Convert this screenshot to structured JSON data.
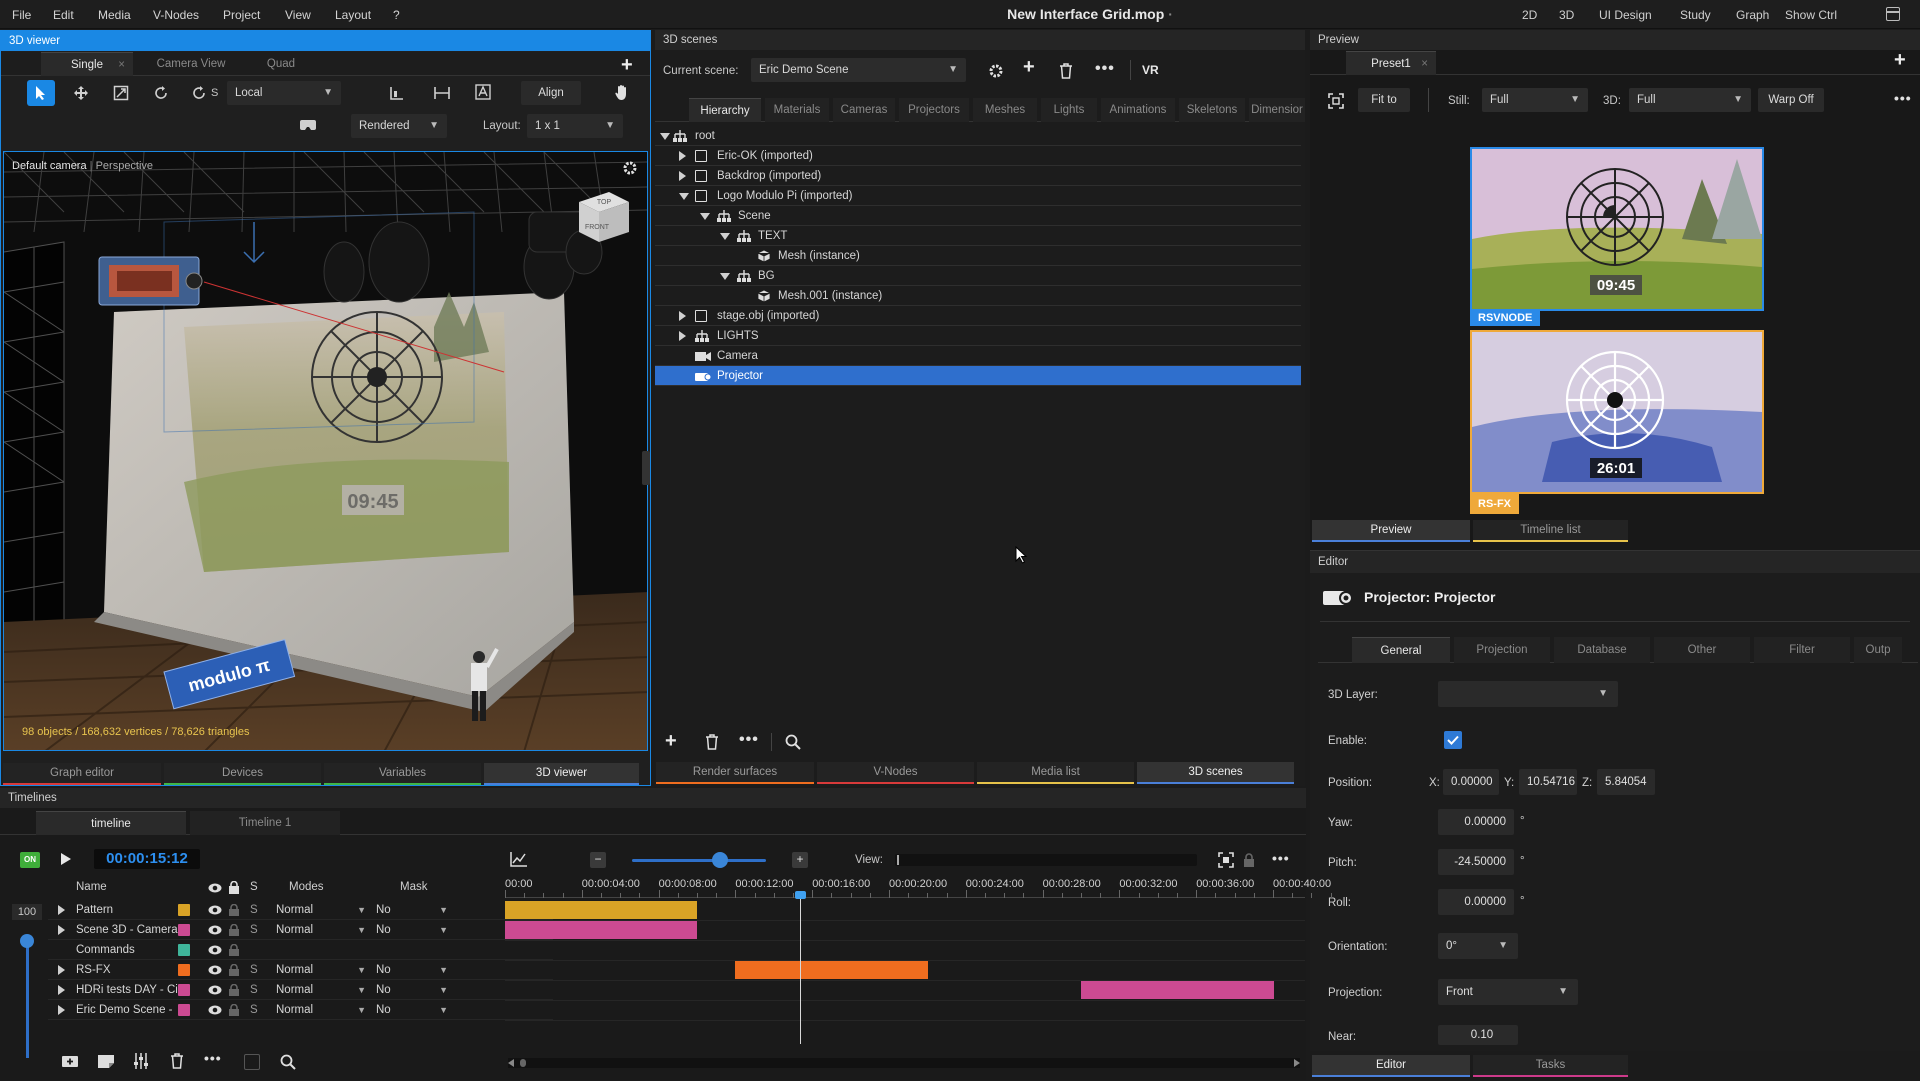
{
  "menu": {
    "file": "File",
    "edit": "Edit",
    "media": "Media",
    "vnodes": "V-Nodes",
    "project": "Project",
    "view": "View",
    "layout": "Layout",
    "help": "?"
  },
  "app_title": "New Interface Grid.mop",
  "title_dot": "·",
  "top_right": {
    "m2d": "2D",
    "m3d": "3D",
    "ui": "UI Design",
    "study": "Study",
    "graph": "Graph",
    "showctrl": "Show Ctrl"
  },
  "viewer": {
    "header": "3D viewer",
    "tabs": {
      "single": "Single",
      "camera": "Camera View",
      "quad": "Quad"
    },
    "space": "Local",
    "snap": "S",
    "align": "Align",
    "render_mode": "Rendered",
    "layout_label": "Layout:",
    "layout_value": "1 x 1",
    "camera_name": "Default camera",
    "camera_sep": "|",
    "camera_mode": "Perspective",
    "gizmo_top": "TOP",
    "gizmo_front": "FRONT",
    "clock": "09:45",
    "logo_text": "modulo π",
    "stats": "98 objects / 168,632 vertices / 78,626 triangles",
    "bottom_tabs": {
      "graph": "Graph editor",
      "devices": "Devices",
      "variables": "Variables",
      "viewer": "3D viewer"
    }
  },
  "scenes": {
    "header": "3D scenes",
    "current_label": "Current scene:",
    "current_value": "Eric Demo Scene",
    "vr": "VR",
    "tabs": {
      "hierarchy": "Hierarchy",
      "materials": "Materials",
      "cameras": "Cameras",
      "projectors": "Projectors",
      "meshes": "Meshes",
      "lights": "Lights",
      "animations": "Animations",
      "skeletons": "Skeletons",
      "dimensions": "Dimensior"
    },
    "tree": {
      "root": "root",
      "eric": "Eric-OK (imported)",
      "backdrop": "Backdrop (imported)",
      "logo": "Logo Modulo Pi (imported)",
      "scene": "Scene",
      "text": "TEXT",
      "mesh": "Mesh (instance)",
      "bg": "BG",
      "mesh001": "Mesh.001 (instance)",
      "stage": "stage.obj (imported)",
      "lights": "LIGHTS",
      "camera": "Camera",
      "projector": "Projector"
    },
    "bottom_tabs": {
      "render": "Render surfaces",
      "vnodes": "V-Nodes",
      "media": "Media list",
      "scenes": "3D scenes"
    }
  },
  "preview": {
    "header": "Preview",
    "tab": "Preset1",
    "fit": "Fit to",
    "still_label": "Still:",
    "still_value": "Full",
    "d3_label": "3D:",
    "d3_value": "Full",
    "warp": "Warp Off",
    "clock1": "09:45",
    "clock2": "26:01",
    "label1": "RSVNODE",
    "label2": "RS-FX",
    "tabs": {
      "preview": "Preview",
      "timeline": "Timeline list"
    }
  },
  "editor": {
    "header": "Editor",
    "title": "Projector: Projector",
    "tabs": {
      "general": "General",
      "projection": "Projection",
      "database": "Database",
      "other": "Other",
      "filter": "Filter",
      "output": "Outp"
    },
    "layer_label": "3D Layer:",
    "enable_label": "Enable:",
    "position_label": "Position:",
    "x_label": "X:",
    "x": "0.00000",
    "y_label": "Y:",
    "y": "10.54716",
    "z_label": "Z:",
    "z": "5.84054",
    "yaw_label": "Yaw:",
    "yaw": "0.00000",
    "pitch_label": "Pitch:",
    "pitch": "-24.50000",
    "roll_label": "Roll:",
    "roll": "0.00000",
    "deg": "°",
    "orientation_label": "Orientation:",
    "orientation": "0°",
    "projection_label": "Projection:",
    "projection": "Front",
    "near_label": "Near:",
    "near": "0.10",
    "bottom_tabs": {
      "editor": "Editor",
      "tasks": "Tasks"
    }
  },
  "timelines": {
    "header": "Timelines",
    "tabs": {
      "timeline": "timeline",
      "timeline1": "Timeline 1"
    },
    "on": "ON",
    "time": "00:00:15:12",
    "view_label": "View:",
    "zoom": "100",
    "cols": {
      "name": "Name",
      "s": "S",
      "modes": "Modes",
      "mask": "Mask"
    },
    "ticks": [
      "00:00",
      "00:00:04:00",
      "00:00:08:00",
      "00:00:12:00",
      "00:00:16:00",
      "00:00:20:00",
      "00:00:24:00",
      "00:00:28:00",
      "00:00:32:00",
      "00:00:36:00",
      "00:00:40:00"
    ],
    "rows": [
      {
        "name": "Pattern",
        "color": "#d9a326",
        "mode": "Normal",
        "mask": "No"
      },
      {
        "name": "Scene 3D - Camera",
        "color": "#cc4a92",
        "mode": "Normal",
        "mask": "No"
      },
      {
        "name": "Commands",
        "color": "#3fb59a",
        "mode": "",
        "mask": ""
      },
      {
        "name": "RS-FX",
        "color": "#ef6d1f",
        "mode": "Normal",
        "mask": "No"
      },
      {
        "name": "HDRi tests DAY - Ci",
        "color": "#cc4a92",
        "mode": "Normal",
        "mask": "No"
      },
      {
        "name": "Eric Demo Scene -",
        "color": "#cc4a92",
        "mode": "Normal",
        "mask": "No"
      }
    ]
  }
}
